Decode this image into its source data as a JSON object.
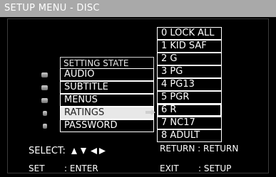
{
  "title": "SETUP MENU - DISC",
  "menu": {
    "header": "SETTING STATE",
    "items": [
      "AUDIO",
      "SUBTITLE",
      "MENUS",
      "RATINGS",
      "PASSWORD"
    ],
    "selected_index": 3
  },
  "ratings": {
    "options": [
      "0 LOCK ALL",
      "1 KID SAF",
      "2 G",
      "3 PG",
      "4 PG13",
      "5 PGR",
      "6 R",
      "7 NC17",
      "8 ADULT"
    ]
  },
  "footer": {
    "select_label": "SELECT:",
    "return_label": "RETURN : RETURN",
    "set_key": "SET",
    "set_action": ": ENTER",
    "exit_key": "EXIT",
    "exit_action": ": SETUP"
  },
  "icons": {
    "arrows": [
      "arrow-up-icon",
      "arrow-down-icon",
      "arrow-left-icon",
      "arrow-right-icon"
    ],
    "bullets": "menu-bullet-icon"
  },
  "colors": {
    "titlebar": "#a9a9a9",
    "selected_item_bg": "#e8e8e8",
    "background": "#000000",
    "text": "#ffffff"
  }
}
